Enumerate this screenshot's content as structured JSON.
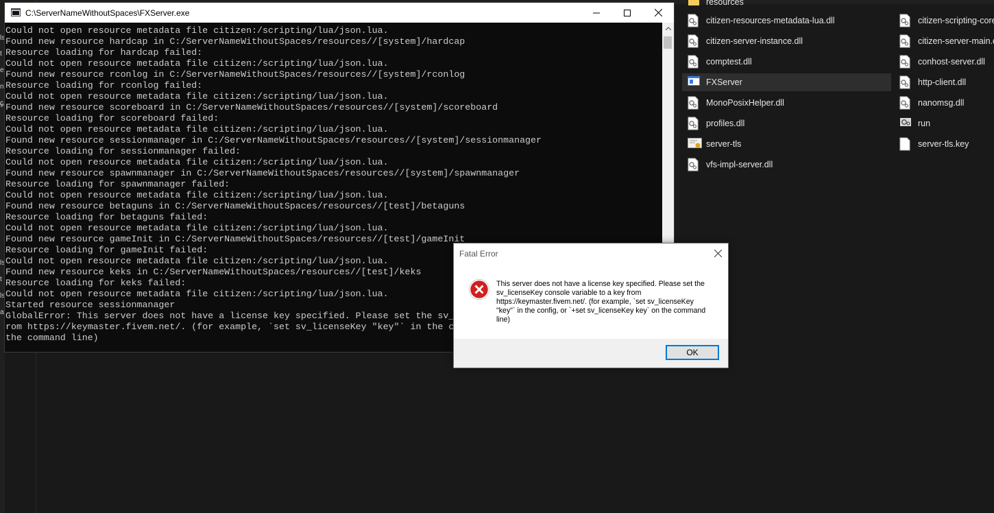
{
  "console": {
    "title": "C:\\ServerNameWithoutSpaces\\FXServer.exe",
    "lines": [
      "Could not open resource metadata file citizen:/scripting/lua/json.lua.",
      "Found new resource hardcap in C:/ServerNameWithoutSpaces/resources//[system]/hardcap",
      "Resource loading for hardcap failed:",
      "Could not open resource metadata file citizen:/scripting/lua/json.lua.",
      "Found new resource rconlog in C:/ServerNameWithoutSpaces/resources//[system]/rconlog",
      "Resource loading for rconlog failed:",
      "Could not open resource metadata file citizen:/scripting/lua/json.lua.",
      "Found new resource scoreboard in C:/ServerNameWithoutSpaces/resources//[system]/scoreboard",
      "Resource loading for scoreboard failed:",
      "Could not open resource metadata file citizen:/scripting/lua/json.lua.",
      "Found new resource sessionmanager in C:/ServerNameWithoutSpaces/resources//[system]/sessionmanager",
      "Resource loading for sessionmanager failed:",
      "Could not open resource metadata file citizen:/scripting/lua/json.lua.",
      "Found new resource spawnmanager in C:/ServerNameWithoutSpaces/resources//[system]/spawnmanager",
      "Resource loading for spawnmanager failed:",
      "Could not open resource metadata file citizen:/scripting/lua/json.lua.",
      "Found new resource betaguns in C:/ServerNameWithoutSpaces/resources//[test]/betaguns",
      "Resource loading for betaguns failed:",
      "Could not open resource metadata file citizen:/scripting/lua/json.lua.",
      "Found new resource gameInit in C:/ServerNameWithoutSpaces/resources//[test]/gameInit",
      "Resource loading for gameInit failed:",
      "Could not open resource metadata file citizen:/scripting/lua/json.lua.",
      "Found new resource keks in C:/ServerNameWithoutSpaces/resources//[test]/keks",
      "Resource loading for keks failed:",
      "Could not open resource metadata file citizen:/scripting/lua/json.lua.",
      "Started resource sessionmanager",
      "GlobalError: This server does not have a license key specified. Please set the sv_licenseKey console variable to a key f",
      "rom https://keymaster.fivem.net/. (for example, `set sv_licenseKey \"key\"` in the config, or `+set sv_licenseKey key` on",
      "the command line)"
    ]
  },
  "explorer": {
    "files": [
      {
        "name": "resources",
        "icon": "folder-icon"
      },
      {
        "name": "citizen-resources-metadata-lua.dll",
        "icon": "dll-file-icon"
      },
      {
        "name": "citizen-server-instance.dll",
        "icon": "dll-file-icon"
      },
      {
        "name": "comptest.dll",
        "icon": "dll-file-icon"
      },
      {
        "name": "FXServer",
        "icon": "exe-app-icon"
      },
      {
        "name": "MonoPosixHelper.dll",
        "icon": "dll-file-icon"
      },
      {
        "name": "profiles.dll",
        "icon": "dll-file-icon"
      },
      {
        "name": "server-tls",
        "icon": "certificate-icon"
      },
      {
        "name": "vfs-impl-server.dll",
        "icon": "dll-file-icon"
      },
      {
        "name": "citizen-scripting-core",
        "icon": "dll-file-icon"
      },
      {
        "name": "citizen-server-main.dl",
        "icon": "dll-file-icon"
      },
      {
        "name": "conhost-server.dll",
        "icon": "dll-file-icon"
      },
      {
        "name": "http-client.dll",
        "icon": "dll-file-icon"
      },
      {
        "name": "nanomsg.dll",
        "icon": "dll-file-icon"
      },
      {
        "name": "run",
        "icon": "batch-file-icon"
      },
      {
        "name": "server-tls.key",
        "icon": "blank-file-icon"
      }
    ],
    "left_fragments": [
      "ls",
      "t",
      "e",
      "n",
      "c",
      "ve",
      "ls",
      "t",
      "ls",
      "at"
    ]
  },
  "dialog": {
    "title": "Fatal Error",
    "message": "This server does not have a license key specified. Please set the sv_licenseKey console variable to a key from https://keymaster.fivem.net/. (for example, `set sv_licenseKey \"key\"` in the config, or `+set sv_licenseKey key` on the command line)",
    "ok_label": "OK",
    "icon": "error-icon"
  },
  "colors": {
    "console_bg": "#0c0c0c",
    "console_text": "#cccccc",
    "explorer_bg": "#191919",
    "accent": "#0078d7",
    "error_red": "#d11f1f"
  }
}
